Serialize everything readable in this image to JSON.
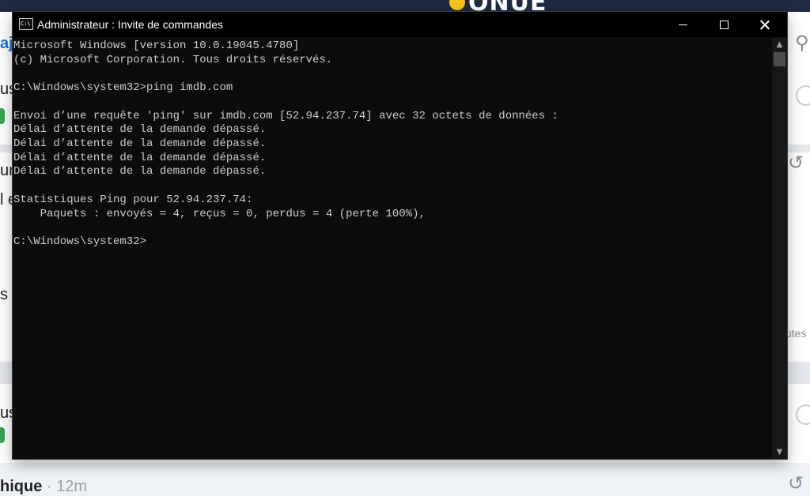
{
  "background_page": {
    "logo_text": "ONUE",
    "snippets": [
      "aj",
      "usc",
      "ur",
      "l e",
      "s",
      "usc"
    ],
    "side_label": "utes",
    "bottom_title": "hique",
    "bottom_time": "· 12m"
  },
  "window": {
    "title": "Administrateur : Invite de commandes",
    "icon_text": "C:\\"
  },
  "console": {
    "lines": [
      "Microsoft Windows [version 10.0.19045.4780]",
      "(c) Microsoft Corporation. Tous droits réservés.",
      "",
      "C:\\Windows\\system32>ping imdb.com",
      "",
      "Envoi d’une requête 'ping' sur imdb.com [52.94.237.74] avec 32 octets de données :",
      "Délai d’attente de la demande dépassé.",
      "Délai d’attente de la demande dépassé.",
      "Délai d’attente de la demande dépassé.",
      "Délai d’attente de la demande dépassé.",
      "",
      "Statistiques Ping pour 52.94.237.74:",
      "    Paquets : envoyés = 4, reçus = 0, perdus = 4 (perte 100%),",
      "",
      "C:\\Windows\\system32>"
    ]
  },
  "colors": {
    "console_bg": "#0c0c0c",
    "console_fg": "#cccccc",
    "titlebar_bg": "#000000"
  },
  "icons": [
    "cmd-app-icon",
    "minimize-icon",
    "maximize-icon",
    "close-icon",
    "scroll-up-icon",
    "scroll-down-icon",
    "history-icon"
  ]
}
